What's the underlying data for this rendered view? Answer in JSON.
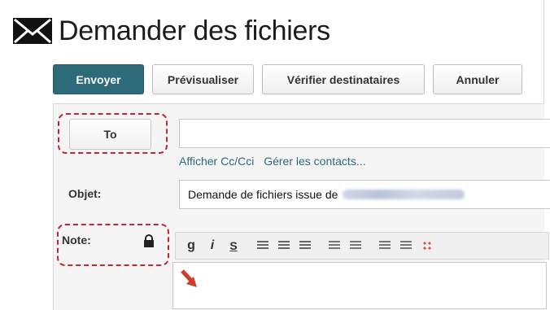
{
  "window": {
    "title": "Demander des fichiers"
  },
  "toolbar": {
    "send": "Envoyer",
    "preview": "Prévisualiser",
    "verify": "Vérifier destinataires",
    "cancel": "Annuler"
  },
  "recipients": {
    "to_label": "To",
    "to_value": "",
    "links": [
      "Afficher Cc/Cci",
      "Gérer les contacts..."
    ]
  },
  "subject": {
    "label": "Objet:",
    "value": "Demande de fichiers issue de"
  },
  "note": {
    "label": "Note:"
  },
  "editor": {
    "toolbar_icons": [
      "bold",
      "italic",
      "strikethrough",
      "align-left",
      "align-center",
      "align-right",
      "unordered-list",
      "ordered-list",
      "indent-increase",
      "indent-decrease",
      "color-picker"
    ]
  },
  "colors": {
    "primary": "#2d6a7a",
    "annotation_red": "#c9252f",
    "arrow_red": "#d23a2b"
  },
  "icons": [
    "envelope-icon",
    "lock-icon",
    "arrow-right-icon",
    "arrow-down-right-icon"
  ]
}
